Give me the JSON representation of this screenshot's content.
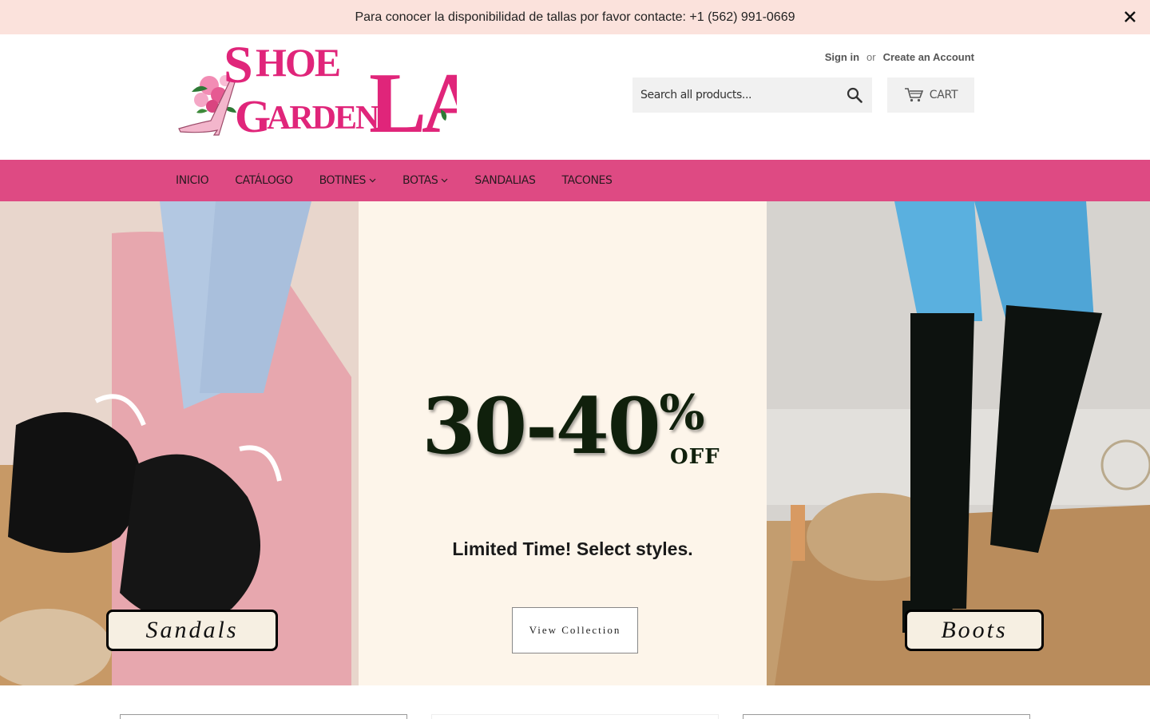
{
  "announcement": {
    "text": "Para conocer la disponibilidad de tallas por favor contacte: +1 (562) 991-0669",
    "close_icon": "close-icon"
  },
  "header": {
    "logo_text": [
      "Shoe",
      "Garden",
      "LA"
    ],
    "sign_in": "Sign in",
    "or": "or",
    "create_account": "Create an Account",
    "search_placeholder": "Search all products...",
    "search_icon": "search-icon",
    "cart_label": "CART",
    "cart_icon": "cart-icon"
  },
  "nav": {
    "items": [
      {
        "label": "INICIO",
        "has_dropdown": false
      },
      {
        "label": "CATÁLOGO",
        "has_dropdown": false
      },
      {
        "label": "BOTINES",
        "has_dropdown": true
      },
      {
        "label": "BOTAS",
        "has_dropdown": true
      },
      {
        "label": "SANDALIAS",
        "has_dropdown": false
      },
      {
        "label": "TACONES",
        "has_dropdown": false
      }
    ]
  },
  "hero": {
    "promo_number": "30-40",
    "promo_percent": "%",
    "promo_off": "OFF",
    "promo_sub": "Limited Time! Select styles.",
    "view_button": "View Collection",
    "left_tag": "Sandals",
    "right_tag": "Boots"
  },
  "colors": {
    "announcement_bg": "#fbe2dc",
    "nav_bg": "#de4a83",
    "logo_pink": "#e0257a",
    "promo_bg": "#fdf5ea"
  }
}
